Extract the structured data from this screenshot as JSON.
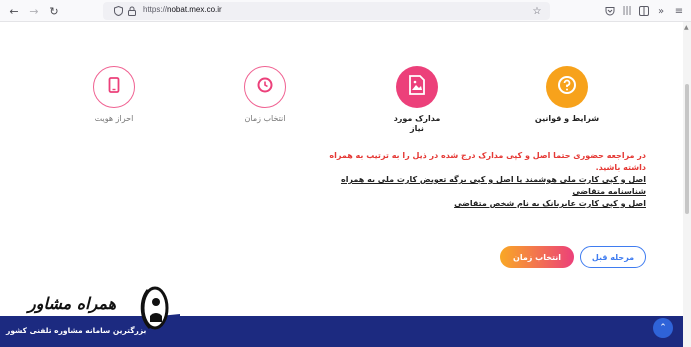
{
  "browser": {
    "url_prefix": "https://",
    "url_domain": "nobat.mex.co.ir",
    "icons": [
      "back-icon",
      "forward-icon",
      "reload-icon",
      "shield-icon",
      "lock-icon",
      "star-icon",
      "pocket-icon",
      "library-icon",
      "reader-icon",
      "overflow-icon"
    ]
  },
  "steps": [
    {
      "label": "شرایط و قوانین",
      "icon": "question-icon",
      "state": "active"
    },
    {
      "label": "مدارک مورد نیاز",
      "icon": "document-icon",
      "state": "active"
    },
    {
      "label": "انتخاب زمان",
      "icon": "clock-icon",
      "state": "inactive"
    },
    {
      "label": "احراز هویت",
      "icon": "mobile-icon",
      "state": "inactive"
    }
  ],
  "notes": {
    "intro": "در مراجعه حضوری حتما اصل و کپی مدارک درج شده در ذیل را به ترتیب به همراه داشته باشید.",
    "item1": "اصل و کپی کارت ملی هوشمند یا اصل و کپی برگه تعویض کارت ملی به همراه شناسنامه متقاضی",
    "item2": "اصل و کپی کارت عابربانک به نام شخص متقاضی"
  },
  "buttons": {
    "prev_label": "مرحله قبل",
    "next_label": "انتخاب زمان"
  },
  "logo": {
    "name": "همراه مشاور",
    "tagline": "بزرگترین سامانه مشاوره تلفنی کشور"
  },
  "colors": {
    "orange": "#f7a21b",
    "pink": "#ec407a",
    "blue": "#3f7cf0",
    "footer": "#1c2a80",
    "red_text": "#e53935"
  }
}
